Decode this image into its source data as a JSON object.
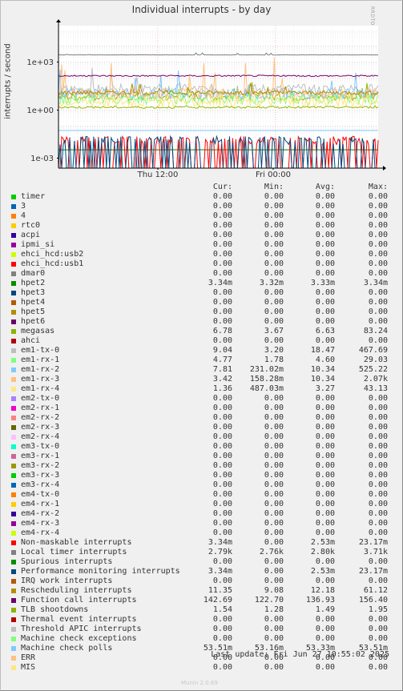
{
  "chart_data": {
    "type": "line",
    "title": "Individual interrupts - by day",
    "ylabel": "interrupts / second",
    "y_scale": "log",
    "y_ticks": [
      "1e+03",
      "1e+00",
      "1e-03"
    ],
    "x_ticks": [
      "Thu 12:00",
      "Fri 00:00"
    ],
    "grid": true,
    "side_label": "RRDTOOL / TOBI OETIKER",
    "columns": [
      "Cur:",
      "Min:",
      "Avg:",
      "Max:"
    ],
    "series": [
      {
        "name": "timer",
        "color": "#00cc00",
        "cur": "0.00",
        "min": "0.00",
        "avg": "0.00",
        "max": "0.00"
      },
      {
        "name": "3",
        "color": "#0066b3",
        "cur": "0.00",
        "min": "0.00",
        "avg": "0.00",
        "max": "0.00"
      },
      {
        "name": "4",
        "color": "#ff8000",
        "cur": "0.00",
        "min": "0.00",
        "avg": "0.00",
        "max": "0.00"
      },
      {
        "name": "rtc0",
        "color": "#ffcc00",
        "cur": "0.00",
        "min": "0.00",
        "avg": "0.00",
        "max": "0.00"
      },
      {
        "name": "acpi",
        "color": "#330099",
        "cur": "0.00",
        "min": "0.00",
        "avg": "0.00",
        "max": "0.00"
      },
      {
        "name": "ipmi_si",
        "color": "#990099",
        "cur": "0.00",
        "min": "0.00",
        "avg": "0.00",
        "max": "0.00"
      },
      {
        "name": "ehci_hcd:usb2",
        "color": "#ccff00",
        "cur": "0.00",
        "min": "0.00",
        "avg": "0.00",
        "max": "0.00"
      },
      {
        "name": "ehci_hcd:usb1",
        "color": "#ff0000",
        "cur": "0.00",
        "min": "0.00",
        "avg": "0.00",
        "max": "0.00"
      },
      {
        "name": "dmar0",
        "color": "#808080",
        "cur": "0.00",
        "min": "0.00",
        "avg": "0.00",
        "max": "0.00"
      },
      {
        "name": "hpet2",
        "color": "#008f00",
        "cur": "3.34m",
        "min": "3.32m",
        "avg": "3.33m",
        "max": "3.34m"
      },
      {
        "name": "hpet3",
        "color": "#00487d",
        "cur": "0.00",
        "min": "0.00",
        "avg": "0.00",
        "max": "0.00"
      },
      {
        "name": "hpet4",
        "color": "#b35a00",
        "cur": "0.00",
        "min": "0.00",
        "avg": "0.00",
        "max": "0.00"
      },
      {
        "name": "hpet5",
        "color": "#b38f00",
        "cur": "0.00",
        "min": "0.00",
        "avg": "0.00",
        "max": "0.00"
      },
      {
        "name": "hpet6",
        "color": "#6b006b",
        "cur": "0.00",
        "min": "0.00",
        "avg": "0.00",
        "max": "0.00"
      },
      {
        "name": "megasas",
        "color": "#8fb300",
        "cur": "6.78",
        "min": "3.67",
        "avg": "6.63",
        "max": "83.24"
      },
      {
        "name": "ahci",
        "color": "#b30000",
        "cur": "0.00",
        "min": "0.00",
        "avg": "0.00",
        "max": "0.00"
      },
      {
        "name": "em1-tx-0",
        "color": "#bebebe",
        "cur": "9.04",
        "min": "3.20",
        "avg": "18.47",
        "max": "467.69"
      },
      {
        "name": "em1-rx-1",
        "color": "#80ff80",
        "cur": "4.77",
        "min": "1.78",
        "avg": "4.60",
        "max": "29.03"
      },
      {
        "name": "em1-rx-2",
        "color": "#80c9ff",
        "cur": "7.81",
        "min": "231.02m",
        "avg": "10.34",
        "max": "525.22"
      },
      {
        "name": "em1-rx-3",
        "color": "#ffc080",
        "cur": "3.42",
        "min": "158.28m",
        "avg": "10.34",
        "max": "2.07k"
      },
      {
        "name": "em1-rx-4",
        "color": "#ffe680",
        "cur": "1.36",
        "min": "487.03m",
        "avg": "3.27",
        "max": "43.13"
      },
      {
        "name": "em2-tx-0",
        "color": "#aa80ff",
        "cur": "0.00",
        "min": "0.00",
        "avg": "0.00",
        "max": "0.00"
      },
      {
        "name": "em2-rx-1",
        "color": "#ee00cc",
        "cur": "0.00",
        "min": "0.00",
        "avg": "0.00",
        "max": "0.00"
      },
      {
        "name": "em2-rx-2",
        "color": "#ff8080",
        "cur": "0.00",
        "min": "0.00",
        "avg": "0.00",
        "max": "0.00"
      },
      {
        "name": "em2-rx-3",
        "color": "#666600",
        "cur": "0.00",
        "min": "0.00",
        "avg": "0.00",
        "max": "0.00"
      },
      {
        "name": "em2-rx-4",
        "color": "#ffbfff",
        "cur": "0.00",
        "min": "0.00",
        "avg": "0.00",
        "max": "0.00"
      },
      {
        "name": "em3-tx-0",
        "color": "#00ffcc",
        "cur": "0.00",
        "min": "0.00",
        "avg": "0.00",
        "max": "0.00"
      },
      {
        "name": "em3-rx-1",
        "color": "#cc6699",
        "cur": "0.00",
        "min": "0.00",
        "avg": "0.00",
        "max": "0.00"
      },
      {
        "name": "em3-rx-2",
        "color": "#999900",
        "cur": "0.00",
        "min": "0.00",
        "avg": "0.00",
        "max": "0.00"
      },
      {
        "name": "em3-rx-3",
        "color": "#00cc00",
        "cur": "0.00",
        "min": "0.00",
        "avg": "0.00",
        "max": "0.00"
      },
      {
        "name": "em3-rx-4",
        "color": "#0066b3",
        "cur": "0.00",
        "min": "0.00",
        "avg": "0.00",
        "max": "0.00"
      },
      {
        "name": "em4-tx-0",
        "color": "#ff8000",
        "cur": "0.00",
        "min": "0.00",
        "avg": "0.00",
        "max": "0.00"
      },
      {
        "name": "em4-rx-1",
        "color": "#ffcc00",
        "cur": "0.00",
        "min": "0.00",
        "avg": "0.00",
        "max": "0.00"
      },
      {
        "name": "em4-rx-2",
        "color": "#330099",
        "cur": "0.00",
        "min": "0.00",
        "avg": "0.00",
        "max": "0.00"
      },
      {
        "name": "em4-rx-3",
        "color": "#990099",
        "cur": "0.00",
        "min": "0.00",
        "avg": "0.00",
        "max": "0.00"
      },
      {
        "name": "em4-rx-4",
        "color": "#ccff00",
        "cur": "0.00",
        "min": "0.00",
        "avg": "0.00",
        "max": "0.00"
      },
      {
        "name": "Non-maskable interrupts",
        "color": "#ff0000",
        "cur": "3.34m",
        "min": "0.00",
        "avg": "2.53m",
        "max": "23.17m"
      },
      {
        "name": "Local timer interrupts",
        "color": "#808080",
        "cur": "2.79k",
        "min": "2.76k",
        "avg": "2.80k",
        "max": "3.71k"
      },
      {
        "name": "Spurious interrupts",
        "color": "#008f00",
        "cur": "0.00",
        "min": "0.00",
        "avg": "0.00",
        "max": "0.00"
      },
      {
        "name": "Performance monitoring interrupts",
        "color": "#00487d",
        "cur": "3.34m",
        "min": "0.00",
        "avg": "2.53m",
        "max": "23.17m"
      },
      {
        "name": "IRQ work interrupts",
        "color": "#b35a00",
        "cur": "0.00",
        "min": "0.00",
        "avg": "0.00",
        "max": "0.00"
      },
      {
        "name": "Rescheduling interrupts",
        "color": "#b38f00",
        "cur": "11.35",
        "min": "9.08",
        "avg": "12.18",
        "max": "61.12"
      },
      {
        "name": "Function call interrupts",
        "color": "#6b006b",
        "cur": "142.69",
        "min": "122.70",
        "avg": "136.93",
        "max": "156.40"
      },
      {
        "name": "TLB shootdowns",
        "color": "#8fb300",
        "cur": "1.54",
        "min": "1.28",
        "avg": "1.49",
        "max": "1.95"
      },
      {
        "name": "Thermal event interrupts",
        "color": "#b30000",
        "cur": "0.00",
        "min": "0.00",
        "avg": "0.00",
        "max": "0.00"
      },
      {
        "name": "Threshold APIC interrupts",
        "color": "#bebebe",
        "cur": "0.00",
        "min": "0.00",
        "avg": "0.00",
        "max": "0.00"
      },
      {
        "name": "Machine check exceptions",
        "color": "#80ff80",
        "cur": "0.00",
        "min": "0.00",
        "avg": "0.00",
        "max": "0.00"
      },
      {
        "name": "Machine check polls",
        "color": "#80c9ff",
        "cur": "53.51m",
        "min": "53.16m",
        "avg": "53.33m",
        "max": "53.51m"
      },
      {
        "name": "ERR",
        "color": "#ffc080",
        "cur": "0.00",
        "min": "0.00",
        "avg": "0.00",
        "max": "0.00"
      },
      {
        "name": "MIS",
        "color": "#ffe680",
        "cur": "0.00",
        "min": "0.00",
        "avg": "0.00",
        "max": "0.00"
      }
    ],
    "last_update": "Last update: Fri Jun 27 10:55:02 2025",
    "watermark": "Munin 2.0.69"
  }
}
